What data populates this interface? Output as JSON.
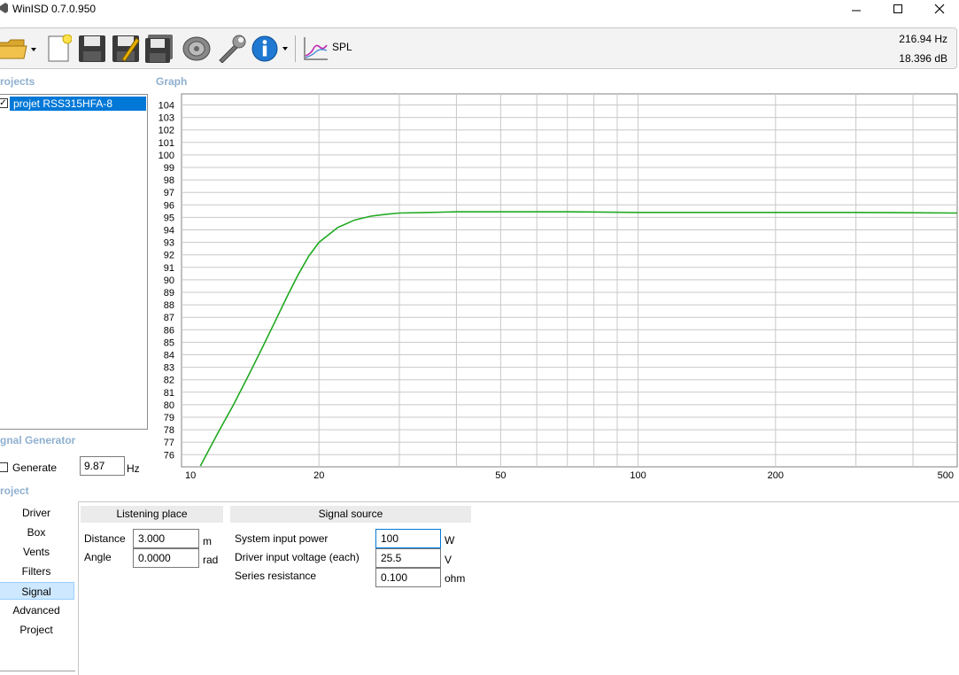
{
  "window": {
    "title": "WinISD 0.7.0.950"
  },
  "toolbar": {
    "icons": [
      "open-folder-icon",
      "new-document-icon",
      "save-icon",
      "save-as-icon",
      "save-all-icon",
      "driver-icon",
      "settings-wrench-icon",
      "info-icon",
      "spl-chart-icon"
    ],
    "spl_label": "SPL",
    "cursor_freq": "216.94 Hz",
    "cursor_level": "18.396 dB"
  },
  "projects": {
    "title": "rojects",
    "items": [
      {
        "label": "projet RSS315HFA-8",
        "checked": true
      }
    ]
  },
  "signal_generator": {
    "title": "gnal Generator",
    "generate_label": "Generate",
    "frequency_value": "9.87",
    "unit": "Hz"
  },
  "project_nav": {
    "title": "roject",
    "items": [
      "Driver",
      "Box",
      "Vents",
      "Filters",
      "Signal",
      "Advanced",
      "Project"
    ],
    "selected": "Signal"
  },
  "graph": {
    "title": "Graph",
    "line_color": "#22aa22"
  },
  "chart_data": {
    "type": "line",
    "x_scale": "log",
    "xlim": [
      10,
      500
    ],
    "ylim": [
      75,
      105
    ],
    "x_tick_labels": [
      "10",
      "20",
      "50",
      "100",
      "200",
      "500"
    ],
    "x_tick_values": [
      10,
      20,
      50,
      100,
      200,
      500
    ],
    "y_tick_labels": [
      "104",
      "103",
      "102",
      "101",
      "100",
      "99",
      "98",
      "97",
      "96",
      "95",
      "94",
      "93",
      "92",
      "91",
      "90",
      "89",
      "88",
      "87",
      "86",
      "85",
      "84",
      "83",
      "82",
      "81",
      "80",
      "79",
      "78",
      "77",
      "76"
    ],
    "y_tick_values": [
      104,
      103,
      102,
      101,
      100,
      99,
      98,
      97,
      96,
      95,
      94,
      93,
      92,
      91,
      90,
      89,
      88,
      87,
      86,
      85,
      84,
      83,
      82,
      81,
      80,
      79,
      78,
      77,
      76
    ],
    "grid": true,
    "series": [
      {
        "color": "#22aa22",
        "x": [
          11,
          12,
          13,
          14,
          15,
          16,
          17,
          18,
          19,
          20,
          22,
          24,
          26,
          28,
          30,
          35,
          40,
          50,
          60,
          70,
          100,
          150,
          200,
          300,
          500
        ],
        "y": [
          75.1,
          77.7,
          80.0,
          82.3,
          84.5,
          86.6,
          88.6,
          90.4,
          91.9,
          93.0,
          94.2,
          94.8,
          95.1,
          95.25,
          95.35,
          95.4,
          95.45,
          95.45,
          95.45,
          95.45,
          95.4,
          95.4,
          95.4,
          95.4,
          95.35
        ]
      }
    ]
  },
  "listening_place": {
    "title": "Listening place",
    "distance_label": "Distance",
    "distance_value": "3.000",
    "distance_unit": "m",
    "angle_label": "Angle",
    "angle_value": "0.0000",
    "angle_unit": "rad"
  },
  "signal_source": {
    "title": "Signal source",
    "power_label": "System input power",
    "power_value": "100",
    "power_unit": "W",
    "voltage_label": "Driver input voltage (each)",
    "voltage_value": "25.5",
    "voltage_unit": "V",
    "resistance_label": "Series resistance",
    "resistance_value": "0.100",
    "resistance_unit": "ohm"
  }
}
